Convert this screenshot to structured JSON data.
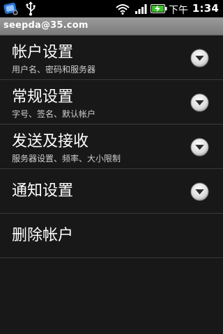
{
  "status_bar": {
    "ampm": "下午",
    "time": "1:34",
    "icons": [
      "app-notification-icon",
      "usb-icon",
      "wifi-icon",
      "signal-icon",
      "battery-charging-icon"
    ]
  },
  "account": {
    "email": "seepda@35.com"
  },
  "settings": [
    {
      "title": "帐户设置",
      "subtitle": "用户名、密码和服务器",
      "icon": "chevron-down-icon"
    },
    {
      "title": "常规设置",
      "subtitle": "字号、签名、默认帐户",
      "icon": "chevron-down-icon"
    },
    {
      "title": "发送及接收",
      "subtitle": "服务器设置、频率、大小限制",
      "icon": "chevron-down-icon"
    },
    {
      "title": "通知设置",
      "subtitle": "",
      "icon": "chevron-down-icon"
    },
    {
      "title": "删除帐户",
      "subtitle": ""
    }
  ],
  "colors": {
    "background": "#181818",
    "account_bar": "#8a8a8a",
    "title_text": "#ffffff",
    "subtitle_text": "#cfcfcf",
    "divider": "#3a3a3a"
  }
}
